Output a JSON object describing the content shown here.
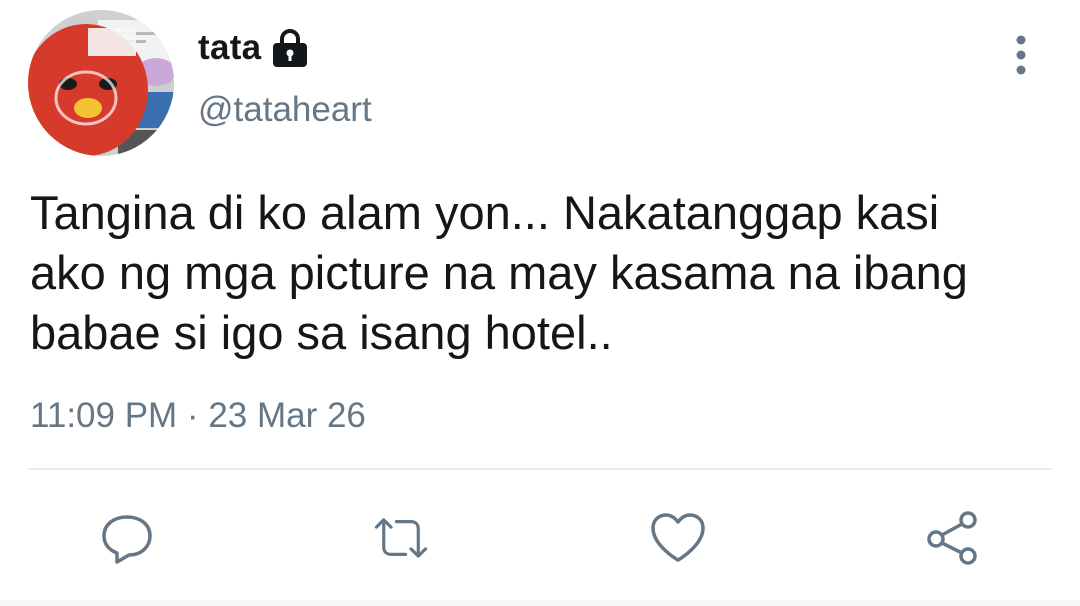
{
  "user": {
    "display_name": "tata",
    "handle": "@tataheart",
    "protected_icon": "lock-icon",
    "avatar_icon": "avatar-image"
  },
  "tweet": {
    "text": "Tangina di ko alam yon... Nakatanggap kasi\nako ng mga picture na may kasama na ibang\nbabae si igo sa isang hotel..",
    "timestamp": "11:09 PM · 23 Mar 26"
  },
  "actions": {
    "reply_icon": "reply-icon",
    "retweet_icon": "retweet-icon",
    "like_icon": "heart-icon",
    "share_icon": "share-icon",
    "more_icon": "more-options-icon"
  },
  "colors": {
    "text_primary": "#14171a",
    "text_secondary": "#657786",
    "icon": "#657786",
    "divider": "#e6ecf0"
  }
}
